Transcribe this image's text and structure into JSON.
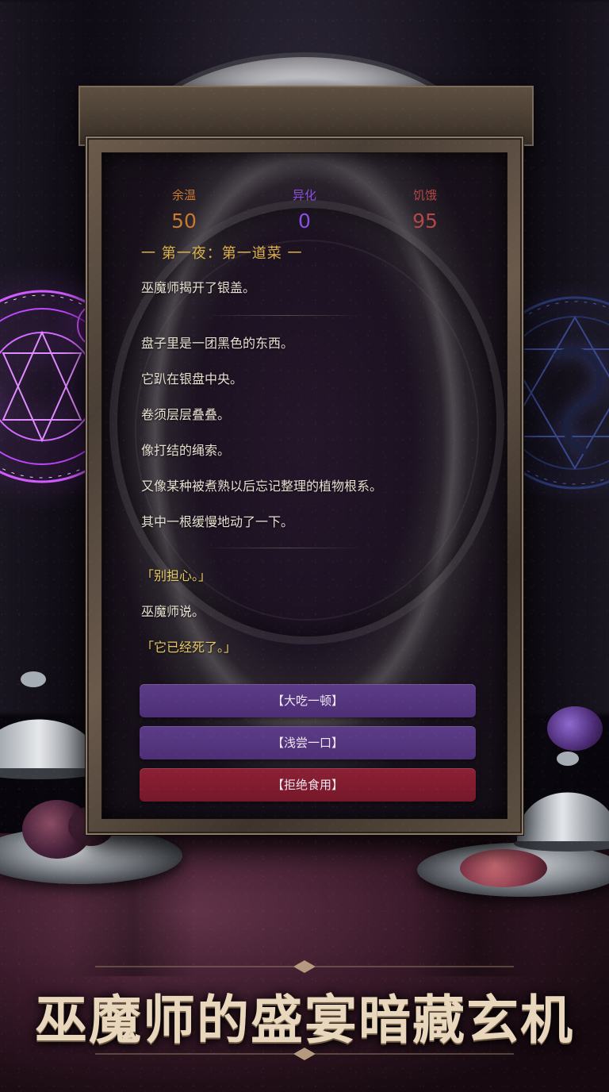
{
  "stats": [
    {
      "label": "余温",
      "value": "50",
      "color": "#c8782f"
    },
    {
      "label": "异化",
      "value": "0",
      "color": "#8a4fe0"
    },
    {
      "label": "饥饿",
      "value": "95",
      "color": "#b24747"
    }
  ],
  "story": {
    "chapter_title": "一 第一夜：第一道菜 一",
    "lines": [
      "巫魔师揭开了银盖。",
      "盘子里是一团黑色的东西。",
      "它趴在银盘中央。",
      "卷须层层叠叠。",
      "像打结的绳索。",
      "又像某种被煮熟以后忘记整理的植物根系。",
      "其中一根缓慢地动了一下。",
      "「别担心。」",
      "巫魔师说。",
      "「它已经死了。」"
    ]
  },
  "choices": [
    {
      "label": "【大吃一顿】",
      "style": "purple",
      "color": "#5c3c88"
    },
    {
      "label": "【浅尝一口】",
      "style": "purple",
      "color": "#5c3c88"
    },
    {
      "label": "【拒绝食用】",
      "style": "red",
      "color": "#8c2035"
    }
  ],
  "promo": {
    "headline": "巫魔师的盛宴暗藏玄机"
  }
}
